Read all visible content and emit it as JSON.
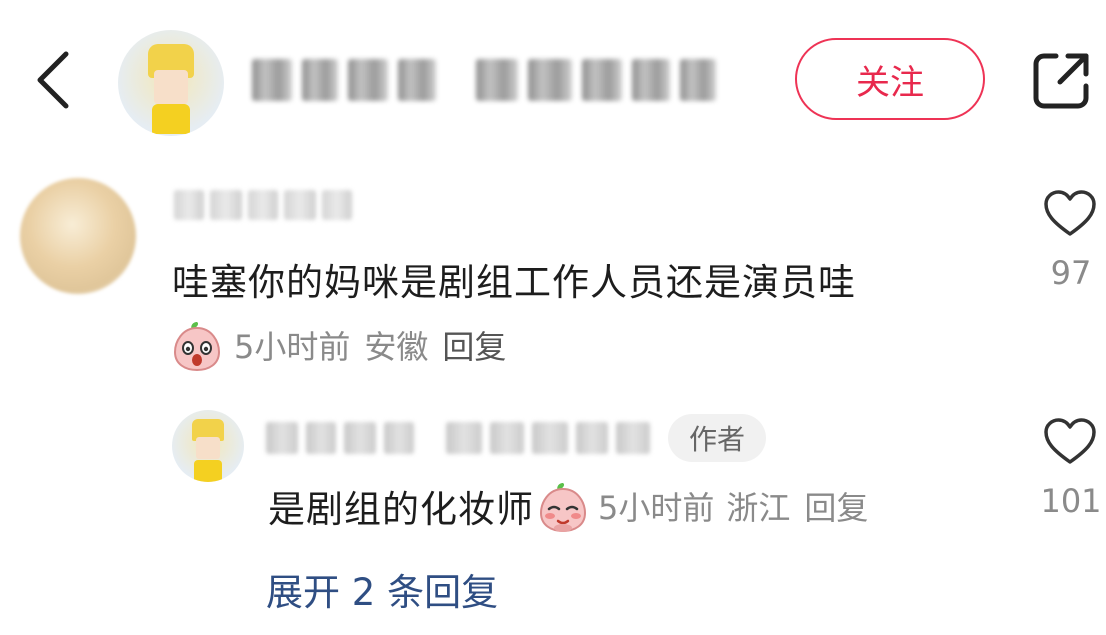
{
  "header": {
    "follow_label": "关注",
    "icons": {
      "back": "chevron-left-icon",
      "share": "external-share-icon"
    }
  },
  "comment": {
    "text": "哇塞你的妈咪是剧组工作人员还是演员哇",
    "time": "5小时前",
    "location": "安徽",
    "reply_label": "回复",
    "like_count": "97"
  },
  "reply": {
    "author_badge": "作者",
    "text": "是剧组的化妆师",
    "time": "5小时前",
    "location": "浙江",
    "reply_label": "回复",
    "like_count": "101"
  },
  "expand_label": "展开 2 条回复",
  "colors": {
    "accent": "#e8294d",
    "link": "#2f4e83",
    "meta": "#8a8a8a"
  }
}
